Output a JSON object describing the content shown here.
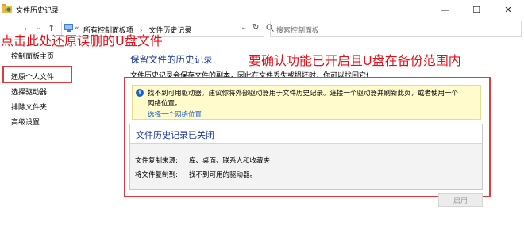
{
  "window": {
    "title": "文件历史记录",
    "minimize_glyph": "—",
    "maximize_glyph": "☐",
    "close_glyph": "✕"
  },
  "nav": {
    "back_glyph": "←",
    "forward_glyph": "→",
    "up_glyph": "↑",
    "breadcrumb_sep": "«",
    "breadcrumb": [
      "所有控制面板项",
      "文件历史记录"
    ],
    "crumb_arrow": "›",
    "dropdown_glyph": "⌄",
    "refresh_glyph": "↻",
    "search_placeholder": "搜索控制面板"
  },
  "sidebar": {
    "home": "控制面板主页",
    "items": [
      "还原个人文件",
      "选择驱动器",
      "排除文件夹",
      "高级设置"
    ]
  },
  "annotations": {
    "top": "点击此处还原误删的U盘文件",
    "right": "要确认功能已开启且U盘在备份范围内"
  },
  "main": {
    "title": "保留文件的历史记录",
    "description": "文件历史记录会保存文件的副本，因此在文件丢失或损坏时，你可以找回它们。",
    "notice": {
      "line1": "找不到可用驱动器。建议你将外部驱动器用于文件历史记录。连接一个驱动器并刷新此页，或者使用一个",
      "line2": "网络位置。",
      "link": "选择一个网络位置"
    },
    "panel": {
      "title": "文件历史记录已关闭",
      "rows": [
        {
          "label": "文件复制来源:",
          "value": "库、桌面、联系人和收藏夹"
        },
        {
          "label": "将文件复制到:",
          "value": "找不到可用的驱动器。"
        }
      ]
    },
    "enable_button": "启用"
  },
  "colors": {
    "annotation_red": "#e8101a",
    "link_blue": "#1f63c8",
    "heading_blue": "#1e3aa0",
    "notice_bg": "#fffbcc"
  }
}
